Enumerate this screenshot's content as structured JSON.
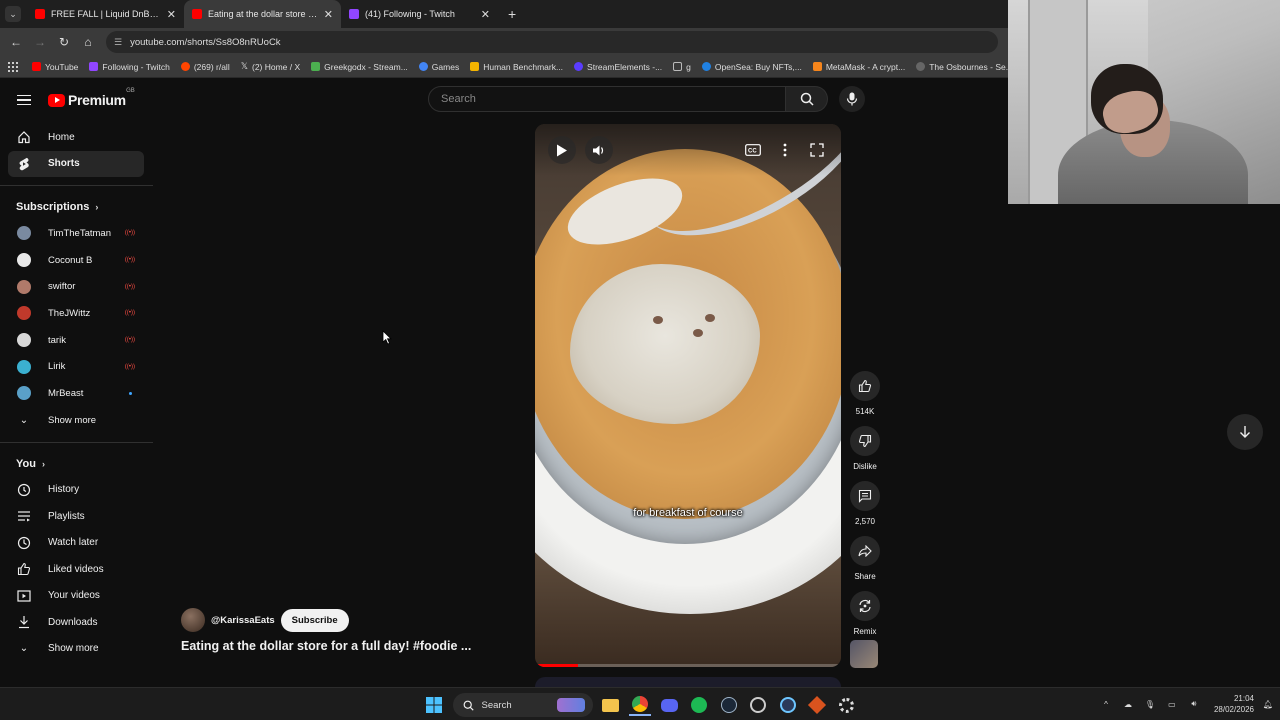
{
  "browser": {
    "tabs": [
      {
        "title": "FREE FALL | Liquid DnB / Jungle",
        "favicon_color": "#ff0000",
        "active": false
      },
      {
        "title": "Eating at the dollar store for a f",
        "favicon_color": "#ff0000",
        "active": true
      },
      {
        "title": "(41) Following - Twitch",
        "favicon_color": "#9146ff",
        "active": false
      }
    ],
    "url": "youtube.com/shorts/Ss8O8nRUoCk",
    "bookmarks": [
      {
        "label": "YouTube",
        "color": "#ff0000"
      },
      {
        "label": "Following - Twitch",
        "color": "#9146ff"
      },
      {
        "label": "(269) r/all",
        "color": "#ff4500"
      },
      {
        "label": "(2) Home / X",
        "color": "#ffffff"
      },
      {
        "label": "Greekgodx - Stream...",
        "color": "#4caf50"
      },
      {
        "label": "Games",
        "color": "#4285f4"
      },
      {
        "label": "Human Benchmark...",
        "color": "#f4b400"
      },
      {
        "label": "StreamElements -...",
        "color": "#5a3cff"
      },
      {
        "label": "g",
        "color": "#999999"
      },
      {
        "label": "OpenSea: Buy NFTs,...",
        "color": "#2081e2"
      },
      {
        "label": "MetaMask - A crypt...",
        "color": "#f6851b"
      },
      {
        "label": "The Osbournes - Se...",
        "color": "#cccccc"
      }
    ]
  },
  "youtube": {
    "brand": "Premium",
    "region": "GB",
    "search_placeholder": "Search",
    "nav": [
      {
        "label": "Home",
        "icon": "home-icon"
      },
      {
        "label": "Shorts",
        "icon": "shorts-icon"
      }
    ],
    "subscriptions_title": "Subscriptions",
    "subscriptions": [
      {
        "name": "TimTheTatman",
        "live": true,
        "color": "#7a8aa0"
      },
      {
        "name": "Coconut B",
        "live": true,
        "color": "#e8e8e8"
      },
      {
        "name": "swiftor",
        "live": true,
        "color": "#b07a6a"
      },
      {
        "name": "TheJWittz",
        "live": true,
        "color": "#c0392b"
      },
      {
        "name": "tarik",
        "live": true,
        "color": "#d8d8d8"
      },
      {
        "name": "Lirik",
        "live": true,
        "color": "#3bb0d0"
      },
      {
        "name": "MrBeast",
        "live": false,
        "color": "#5aa0c8"
      }
    ],
    "show_more": "Show more",
    "you_title": "You",
    "you_items": [
      {
        "label": "History",
        "icon": "history-icon"
      },
      {
        "label": "Playlists",
        "icon": "playlists-icon"
      },
      {
        "label": "Watch later",
        "icon": "clock-icon"
      },
      {
        "label": "Liked videos",
        "icon": "thumbs-up-icon"
      },
      {
        "label": "Your videos",
        "icon": "video-icon"
      },
      {
        "label": "Downloads",
        "icon": "download-icon"
      }
    ],
    "show_more_2": "Show more",
    "short": {
      "caption": "for breakfast of course",
      "progress": 0.14,
      "channel": "@KarissaEats",
      "subscribe": "Subscribe",
      "title": "Eating at the dollar store for a full day! #foodie ...",
      "likes": "514K",
      "dislike": "Dislike",
      "comments": "2,570",
      "share": "Share",
      "remix": "Remix"
    }
  },
  "taskbar": {
    "search": "Search",
    "time": "21:04",
    "date": "28/02/2026"
  }
}
